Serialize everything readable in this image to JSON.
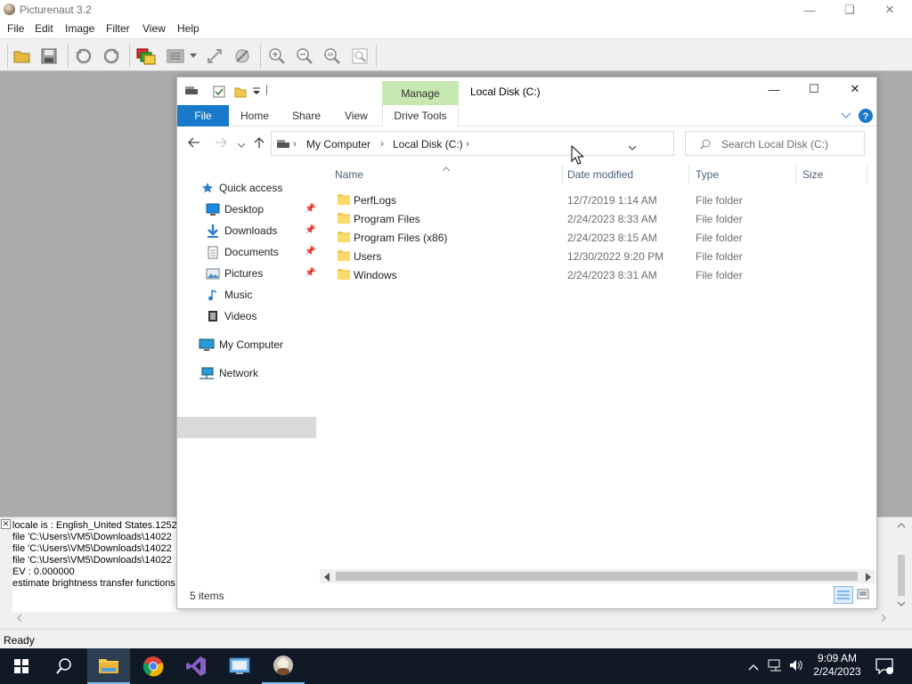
{
  "picturenaut": {
    "title": "Picturenaut 3.2",
    "menu": [
      "File",
      "Edit",
      "Image",
      "Filter",
      "View",
      "Help"
    ],
    "toolbar_icons": [
      "open-folder-icon",
      "save-icon",
      "rotate-left-icon",
      "rotate-right-icon",
      "layers-icon",
      "list-icon",
      "crop-icon",
      "adjust-icon",
      "zoom-in-icon",
      "zoom-out-icon",
      "zoom-fit-icon",
      "zoom-actual-icon"
    ],
    "log_lines": [
      "locale is : English_United States.1252",
      "file 'C:\\Users\\VM5\\Downloads\\14022",
      "file 'C:\\Users\\VM5\\Downloads\\14022",
      "file 'C:\\Users\\VM5\\Downloads\\14022",
      "EV : 0.000000",
      "estimate brightness transfer functions ..."
    ],
    "status": "Ready"
  },
  "explorer": {
    "title": "Local Disk (C:)",
    "manage_label": "Manage",
    "tabs": [
      "File",
      "Home",
      "Share",
      "View",
      "Drive Tools"
    ],
    "breadcrumb": [
      "My Computer",
      "Local Disk (C:)"
    ],
    "search_placeholder": "Search Local Disk (C:)",
    "nav": {
      "quick_access": "Quick access",
      "items": [
        "Desktop",
        "Downloads",
        "Documents",
        "Pictures",
        "Music",
        "Videos"
      ],
      "my_computer": "My Computer",
      "network": "Network"
    },
    "columns": [
      "Name",
      "Date modified",
      "Type",
      "Size"
    ],
    "files": [
      {
        "name": "PerfLogs",
        "date": "12/7/2019 1:14 AM",
        "type": "File folder"
      },
      {
        "name": "Program Files",
        "date": "2/24/2023 8:33 AM",
        "type": "File folder"
      },
      {
        "name": "Program Files (x86)",
        "date": "2/24/2023 8:15 AM",
        "type": "File folder"
      },
      {
        "name": "Users",
        "date": "12/30/2022 9:20 PM",
        "type": "File folder"
      },
      {
        "name": "Windows",
        "date": "2/24/2023 8:31 AM",
        "type": "File folder"
      }
    ],
    "item_count": "5 items"
  },
  "taskbar": {
    "apps": [
      "start-icon",
      "search-icon",
      "file-explorer-icon",
      "chrome-icon",
      "visual-studio-icon",
      "control-panel-icon",
      "picturenaut-icon"
    ],
    "time": "9:09 AM",
    "date": "2/24/2023"
  },
  "colors": {
    "accent": "#1979ca",
    "manage_bg": "#c6e8b0",
    "taskbar": "#101a26",
    "folder": "#f5c84c"
  }
}
